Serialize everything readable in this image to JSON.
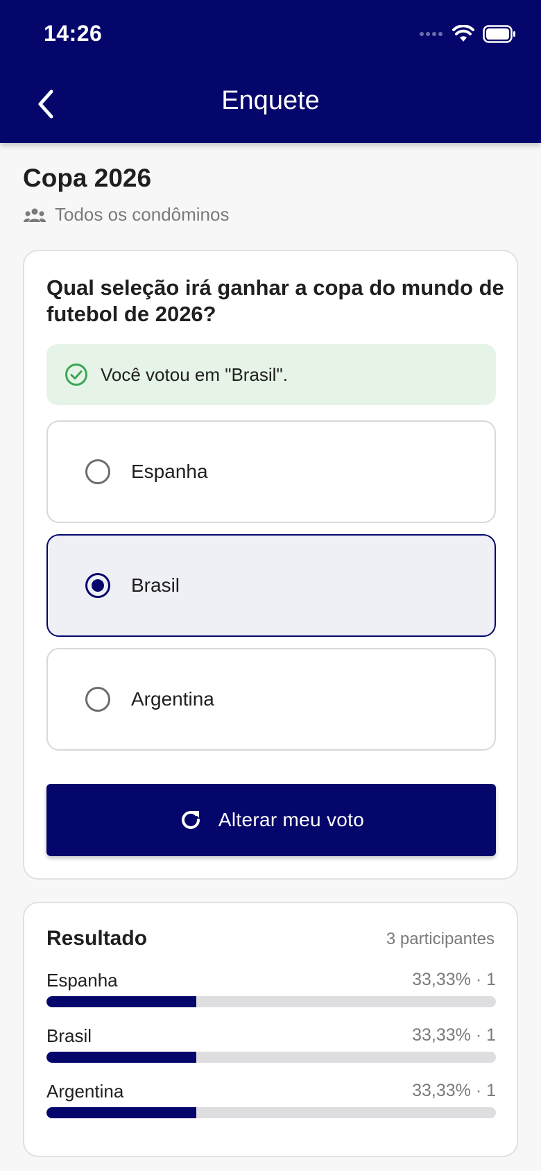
{
  "status_bar": {
    "time": "14:26"
  },
  "appbar": {
    "title": "Enquete"
  },
  "poll": {
    "title": "Copa 2026",
    "audience": "Todos os condôminos",
    "question": "Qual seleção irá ganhar a copa do mundo de futebol de 2026?",
    "voted_message": "Você votou em \"Brasil\".",
    "options": [
      {
        "label": "Espanha",
        "selected": false
      },
      {
        "label": "Brasil",
        "selected": true
      },
      {
        "label": "Argentina",
        "selected": false
      }
    ],
    "change_vote_label": "Alterar meu voto"
  },
  "results": {
    "title": "Resultado",
    "participants": "3 participantes",
    "rows": [
      {
        "label": "Espanha",
        "value": "33,33% · 1",
        "percent": 33.33
      },
      {
        "label": "Brasil",
        "value": "33,33% · 1",
        "percent": 33.33
      },
      {
        "label": "Argentina",
        "value": "33,33% · 1",
        "percent": 33.33
      }
    ]
  },
  "colors": {
    "primary": "#05066b",
    "success_bg": "#e6f4e7",
    "success_icon": "#3aa655"
  }
}
